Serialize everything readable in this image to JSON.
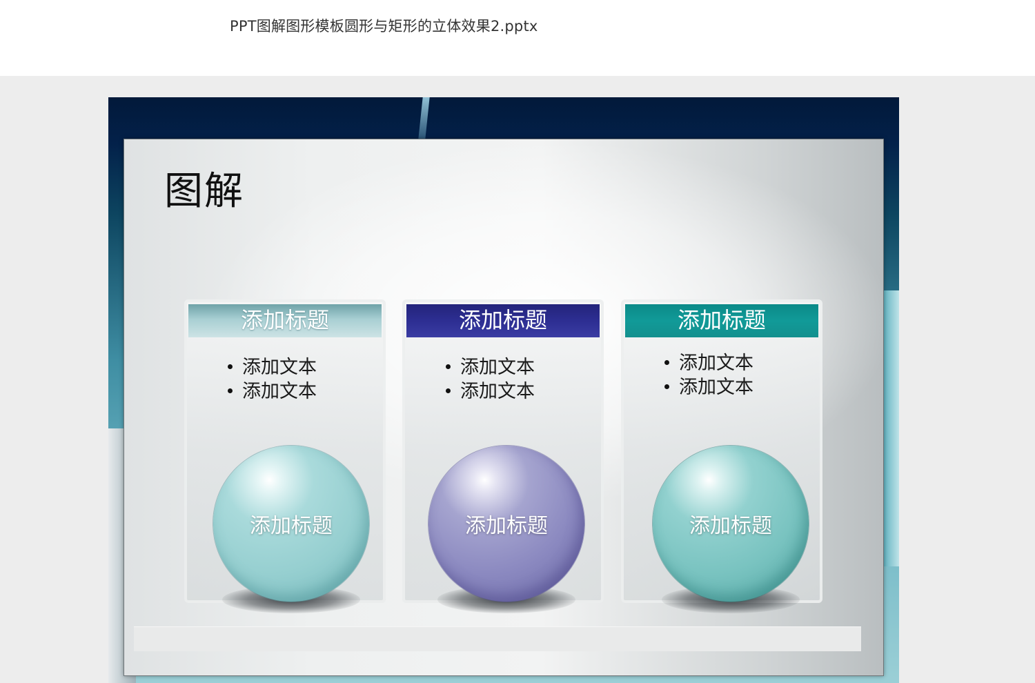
{
  "file": {
    "title": "PPT图解图形模板圆形与矩形的立体效果2.pptx"
  },
  "slide": {
    "title": "图解",
    "cards": [
      {
        "header": "添加标题",
        "bullets": [
          "添加文本",
          "添加文本"
        ],
        "sphere_label": "添加标题",
        "header_color": "#a8cfd3",
        "sphere_color": "#96cfd0"
      },
      {
        "header": "添加标题",
        "bullets": [
          "添加文本",
          "添加文本"
        ],
        "sphere_label": "添加标题",
        "header_color": "#2d2e92",
        "sphere_color": "#8b89c0"
      },
      {
        "header": "添加标题",
        "bullets": [
          "添加文本",
          "添加文本"
        ],
        "sphere_label": "添加标题",
        "header_color": "#119a98",
        "sphere_color": "#79c3c0"
      }
    ]
  },
  "colors": {
    "page_background": "#ededed",
    "slide_background": "#03214a",
    "panel_background": "#eef0f0"
  }
}
